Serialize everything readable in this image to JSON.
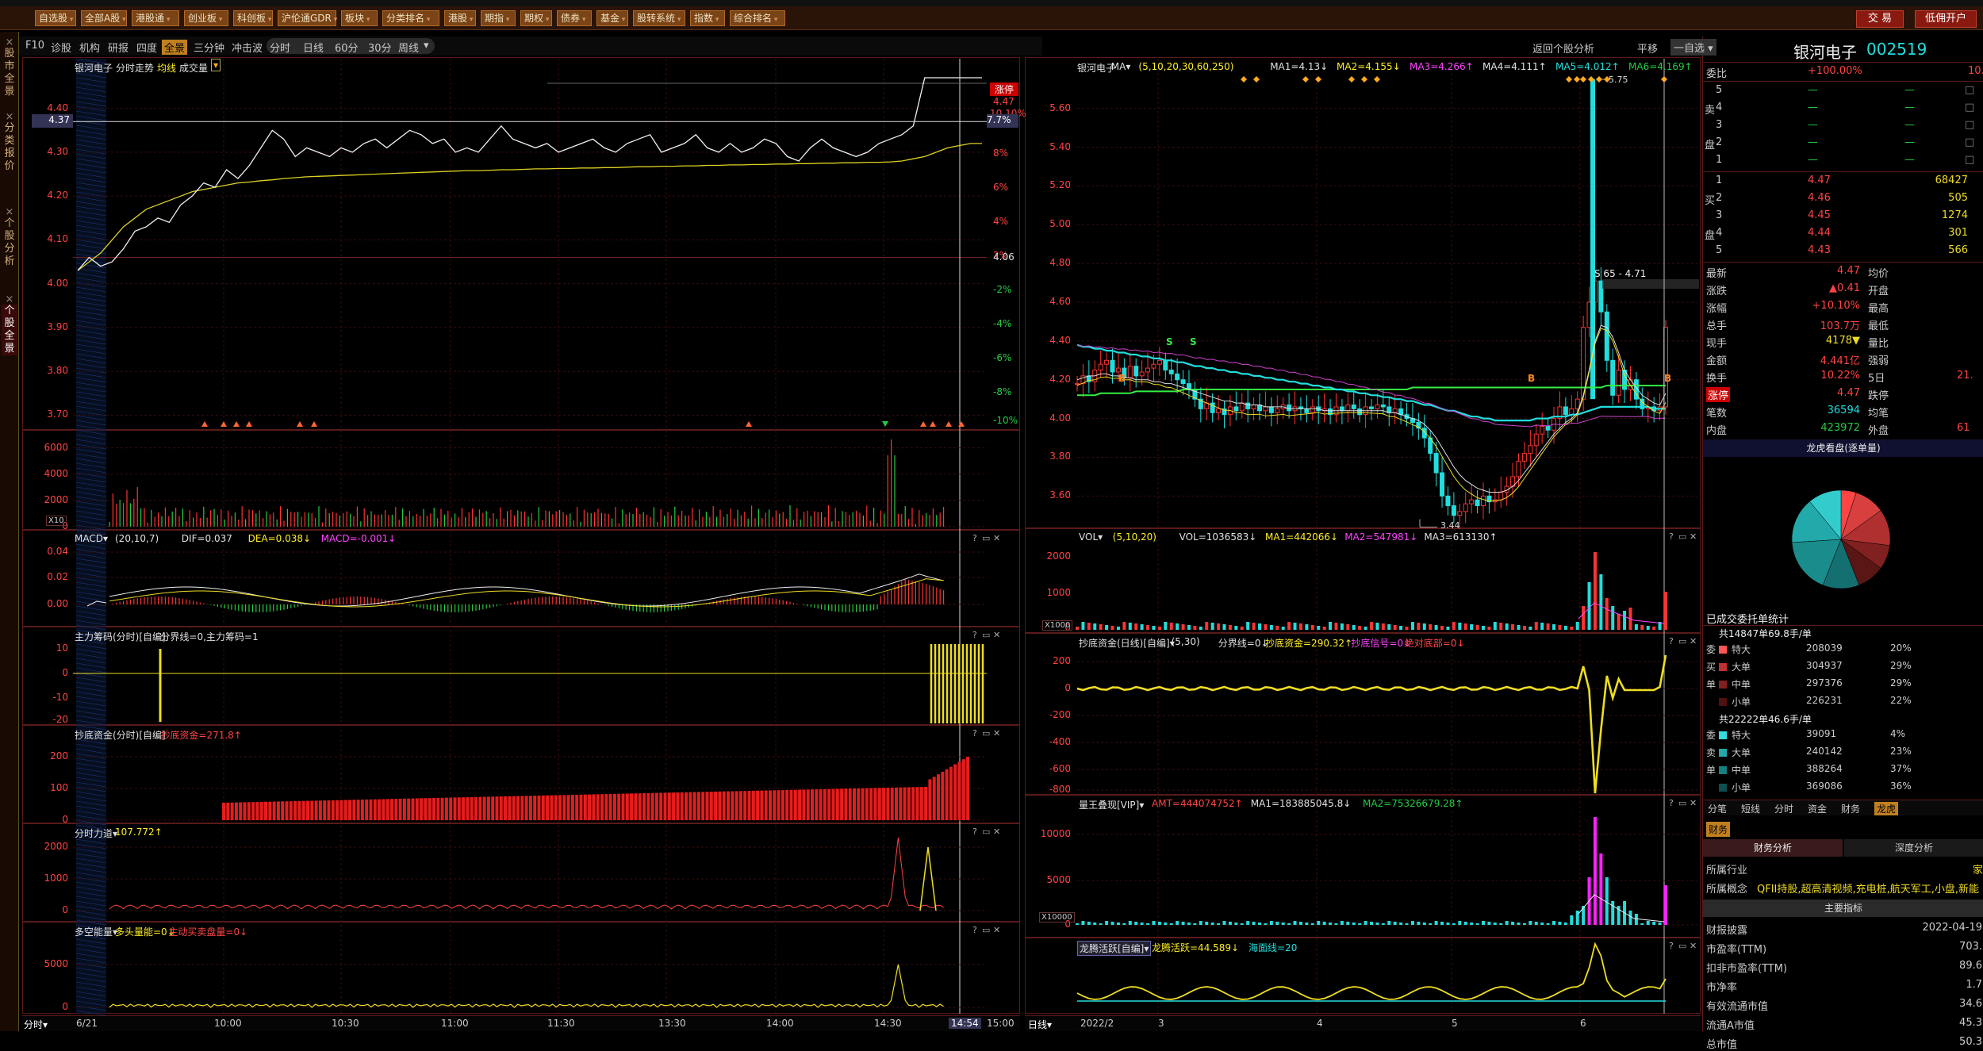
{
  "menubar": {
    "items": [
      "自选股",
      "全部A股",
      "港股通",
      "创业板",
      "科创板",
      "沪伦通GDR",
      "板块",
      "分类排名",
      "港股",
      "期指",
      "期权",
      "债券",
      "基金",
      "股转系统",
      "指数",
      "综合排名"
    ],
    "trade_button": "交 易",
    "margin_button": "低佣开户"
  },
  "leftstrip": {
    "tabs": [
      "股市全景",
      "分类报价",
      "个股分析",
      "个股全景"
    ]
  },
  "toolbar": {
    "items": [
      "F10",
      "诊股",
      "机构",
      "研报",
      "四度",
      "全景",
      "三分钟",
      "冲击波"
    ],
    "period_items": [
      "分时",
      "日线",
      "60分",
      "30分",
      "周线"
    ],
    "right_items": [
      "返回个股分析",
      "平移",
      "一自选"
    ]
  },
  "intraday": {
    "title": "银河电子",
    "subtitle": "分时走势",
    "legend_avg": "均线",
    "legend_vol": "成交量",
    "price_ticks": [
      "4.40",
      "4.30",
      "4.20",
      "4.10",
      "4.00",
      "3.90",
      "3.80",
      "3.70"
    ],
    "current_price_label": "4.37",
    "pct_ticks": [
      "8%",
      "6%",
      "4%",
      "2%",
      "4.06",
      "-2%",
      "-4%",
      "-6%",
      "-8%",
      "-10%"
    ],
    "limit_label": "涨停",
    "limit_price": "4.47",
    "limit_pct": "10.10%",
    "right_pct_label": "7.7%",
    "vol_ticks": [
      "6000",
      "4000",
      "2000",
      "0"
    ],
    "vol_unit": "X10",
    "price_series": [
      4.03,
      4.06,
      4.04,
      4.05,
      4.08,
      4.12,
      4.13,
      4.15,
      4.14,
      4.18,
      4.2,
      4.23,
      4.22,
      4.26,
      4.24,
      4.27,
      4.31,
      4.35,
      4.33,
      4.29,
      4.31,
      4.3,
      4.29,
      4.31,
      4.3,
      4.32,
      4.33,
      4.31,
      4.33,
      4.35,
      4.34,
      4.32,
      4.33,
      4.3,
      4.31,
      4.3,
      4.33,
      4.36,
      4.33,
      4.32,
      4.31,
      4.32,
      4.3,
      4.31,
      4.32,
      4.33,
      4.31,
      4.3,
      4.32,
      4.33,
      4.34,
      4.3,
      4.31,
      4.32,
      4.34,
      4.31,
      4.3,
      4.32,
      4.3,
      4.31,
      4.33,
      4.32,
      4.29,
      4.28,
      4.31,
      4.33,
      4.31,
      4.3,
      4.29,
      4.3,
      4.32,
      4.33,
      4.34,
      4.36,
      4.47,
      4.47,
      4.47,
      4.47,
      4.47,
      4.47
    ],
    "avg_series": [
      4.03,
      4.05,
      4.07,
      4.1,
      4.13,
      4.15,
      4.17,
      4.18,
      4.19,
      4.2,
      4.21,
      4.215,
      4.22,
      4.225,
      4.23,
      4.232,
      4.235,
      4.237,
      4.24,
      4.242,
      4.244,
      4.245,
      4.246,
      4.247,
      4.248,
      4.249,
      4.25,
      4.251,
      4.252,
      4.253,
      4.254,
      4.255,
      4.256,
      4.257,
      4.258,
      4.258,
      4.259,
      4.26,
      4.26,
      4.261,
      4.262,
      4.262,
      4.263,
      4.263,
      4.264,
      4.264,
      4.265,
      4.265,
      4.266,
      4.267,
      4.267,
      4.268,
      4.268,
      4.269,
      4.269,
      4.27,
      4.27,
      4.271,
      4.271,
      4.272,
      4.272,
      4.273,
      4.273,
      4.274,
      4.274,
      4.275,
      4.275,
      4.276,
      4.276,
      4.277,
      4.277,
      4.278,
      4.28,
      4.285,
      4.29,
      4.3,
      4.31,
      4.315,
      4.32,
      4.32
    ],
    "ylim": [
      3.67,
      4.47
    ],
    "time_labels": [
      "6/21",
      "10:00",
      "10:30",
      "11:00",
      "11:30",
      "13:30",
      "14:00",
      "14:30",
      "14:54",
      "15:00"
    ],
    "bottom_label": "分时"
  },
  "macd": {
    "label": "MACD",
    "params": "(20,10,7)",
    "dif": "DIF=0.037",
    "dea": "DEA=0.038",
    "macd": "MACD=-0.001",
    "ticks": [
      "0.04",
      "0.02",
      "0.00"
    ]
  },
  "zhuli": {
    "label": "主力筹码(分时)[自编]",
    "text": "分界线=0,主力筹码=1",
    "ticks": [
      "10",
      "0",
      "-10",
      "-20"
    ]
  },
  "chaodi": {
    "label": "抄底资金(分时)[自编]",
    "text": "抄底资金=271.8",
    "ticks": [
      "200",
      "100",
      "0"
    ]
  },
  "fenshi": {
    "label": "分时力道",
    "text": "107.772",
    "ticks": [
      "2000",
      "1000",
      "0"
    ]
  },
  "duokong": {
    "label": "多空能量",
    "text1": "多头量能=0",
    "text2": "主动买卖盘量=0",
    "ticks": [
      "5000",
      "0"
    ]
  },
  "daily": {
    "title": "银河电子",
    "ma_label": "MA",
    "ma_params": "(5,10,20,30,60,250)",
    "ma1": "MA1=4.13",
    "ma2": "MA2=4.155",
    "ma3": "MA3=4.266",
    "ma4": "MA4=4.111",
    "ma5": "MA5=4.012",
    "ma6": "MA6=4.169",
    "price_ticks": [
      "5.60",
      "5.40",
      "5.20",
      "5.00",
      "4.80",
      "4.60",
      "4.40",
      "4.20",
      "4.00",
      "3.80",
      "3.60"
    ],
    "ylim": [
      3.45,
      5.75
    ],
    "high_label": "5.75",
    "low_label": "3.44",
    "s_label": "S 65 - 4.71",
    "close_series": [
      4.18,
      4.22,
      4.19,
      4.25,
      4.28,
      4.3,
      4.24,
      4.26,
      4.21,
      4.27,
      4.22,
      4.24,
      4.26,
      4.28,
      4.3,
      4.25,
      4.23,
      4.2,
      4.18,
      4.15,
      4.1,
      4.05,
      4.08,
      4.03,
      4.05,
      4.02,
      4.06,
      4.04,
      4.08,
      4.05,
      4.07,
      4.04,
      4.06,
      4.03,
      4.05,
      4.07,
      4.04,
      4.06,
      4.05,
      4.03,
      4.06,
      4.04,
      4.05,
      4.02,
      4.06,
      4.04,
      4.07,
      4.05,
      4.02,
      4.06,
      4.05,
      4.07,
      4.06,
      4.03,
      4.05,
      4.02,
      4.0,
      3.98,
      3.95,
      3.9,
      3.82,
      3.72,
      3.6,
      3.55,
      3.5,
      3.52,
      3.56,
      3.58,
      3.55,
      3.6,
      3.57,
      3.58,
      3.62,
      3.65,
      3.7,
      3.78,
      3.82,
      3.86,
      3.92,
      3.96,
      3.94,
      4.0,
      4.06,
      4.02,
      4.05,
      4.1,
      4.47,
      4.6,
      4.71,
      4.55,
      4.3,
      4.12,
      4.25,
      4.15,
      4.2,
      4.1,
      4.05,
      4.06,
      4.04,
      4.06,
      4.47
    ],
    "ma_a": [
      4.2,
      4.21,
      4.22,
      4.22,
      4.23,
      4.23,
      4.22,
      4.22,
      4.21,
      4.21,
      4.2,
      4.2,
      4.2,
      4.19,
      4.19,
      4.18,
      4.18,
      4.17,
      4.16,
      4.15,
      4.14,
      4.13,
      4.12,
      4.11,
      4.1,
      4.09,
      4.09,
      4.08,
      4.08,
      4.07,
      4.07,
      4.07,
      4.06,
      4.06,
      4.06,
      4.06,
      4.05,
      4.05,
      4.05,
      4.05,
      4.05,
      4.05,
      4.04,
      4.04,
      4.04,
      4.04,
      4.04,
      4.04,
      4.04,
      4.04,
      4.04,
      4.04,
      4.04,
      4.03,
      4.03,
      4.02,
      4.01,
      4.0,
      3.99,
      3.97,
      3.94,
      3.9,
      3.85,
      3.8,
      3.75,
      3.71,
      3.68,
      3.66,
      3.64,
      3.63,
      3.62,
      3.62,
      3.62,
      3.63,
      3.65,
      3.68,
      3.72,
      3.76,
      3.8,
      3.84,
      3.88,
      3.92,
      3.95,
      3.98,
      4.0,
      4.03,
      4.12,
      4.25,
      4.4,
      4.48,
      4.47,
      4.42,
      4.34,
      4.25,
      4.2,
      4.16,
      4.12,
      4.1,
      4.08,
      4.07,
      4.13
    ],
    "ma_cyan": [
      4.38,
      4.37,
      4.37,
      4.36,
      4.36,
      4.35,
      4.35,
      4.34,
      4.34,
      4.33,
      4.33,
      4.32,
      4.32,
      4.31,
      4.31,
      4.3,
      4.3,
      4.29,
      4.29,
      4.28,
      4.27,
      4.27,
      4.26,
      4.26,
      4.25,
      4.25,
      4.24,
      4.24,
      4.23,
      4.23,
      4.22,
      4.22,
      4.21,
      4.21,
      4.2,
      4.2,
      4.19,
      4.19,
      4.18,
      4.18,
      4.17,
      4.17,
      4.16,
      4.16,
      4.15,
      4.15,
      4.14,
      4.14,
      4.13,
      4.13,
      4.12,
      4.12,
      4.11,
      4.11,
      4.1,
      4.1,
      4.09,
      4.09,
      4.08,
      4.07,
      4.07,
      4.06,
      4.05,
      4.04,
      4.04,
      4.03,
      4.02,
      4.01,
      4.01,
      4.0,
      4.0,
      3.99,
      3.99,
      3.99,
      3.99,
      3.99,
      3.99,
      3.99,
      4.0,
      4.0,
      4.0,
      4.01,
      4.01,
      4.01,
      4.02,
      4.02,
      4.03,
      4.04,
      4.05,
      4.06,
      4.06,
      4.06,
      4.06,
      4.06,
      4.06,
      4.06,
      4.06,
      4.06,
      4.05,
      4.05,
      4.05
    ],
    "ma_green": [
      4.12,
      4.12,
      4.12,
      4.12,
      4.13,
      4.13,
      4.13,
      4.13,
      4.13,
      4.13,
      4.14,
      4.14,
      4.14,
      4.14,
      4.14,
      4.14,
      4.14,
      4.14,
      4.15,
      4.15,
      4.15,
      4.15,
      4.15,
      4.15,
      4.15,
      4.15,
      4.15,
      4.15,
      4.15,
      4.15,
      4.15,
      4.15,
      4.15,
      4.15,
      4.15,
      4.15,
      4.15,
      4.15,
      4.15,
      4.15,
      4.15,
      4.15,
      4.15,
      4.15,
      4.15,
      4.15,
      4.15,
      4.15,
      4.15,
      4.15,
      4.15,
      4.15,
      4.15,
      4.15,
      4.15,
      4.15,
      4.15,
      4.16,
      4.16,
      4.16,
      4.16,
      4.16,
      4.16,
      4.16,
      4.16,
      4.16,
      4.16,
      4.16,
      4.16,
      4.16,
      4.16,
      4.16,
      4.16,
      4.16,
      4.16,
      4.16,
      4.16,
      4.16,
      4.16,
      4.16,
      4.16,
      4.16,
      4.16,
      4.16,
      4.16,
      4.16,
      4.16,
      4.16,
      4.16,
      4.16,
      4.17,
      4.17,
      4.17,
      4.17,
      4.17,
      4.17,
      4.17,
      4.17,
      4.17,
      4.17,
      4.17
    ],
    "x_labels": [
      "2022/2",
      "3",
      "4",
      "5",
      "6"
    ],
    "bottom_label": "日线"
  },
  "vol": {
    "label": "VOL",
    "params": "(5,10,20)",
    "text": "VOL=1036583",
    "ma1": "MA1=442066",
    "ma2": "MA2=547981",
    "ma3": "MA3=613130",
    "ticks": [
      "2000",
      "1000",
      "0"
    ],
    "unit": "X1000"
  },
  "chaodi_d": {
    "label": "抄底资金(日线)[自编]",
    "params": "(5,30)",
    "text": "分界线=0",
    "text2": "抄底资金=290.32",
    "text3": "抄底信号=0",
    "text4": "绝对底部=0",
    "ticks": [
      "200",
      "0",
      "-200",
      "-400",
      "-600",
      "-800"
    ]
  },
  "liangwang": {
    "label": "量王叠现[VIP]",
    "amt": "AMT=444074752",
    "ma1": "MA1=183885045.8",
    "ma2": "MA2=75326679.28",
    "ticks": [
      "10000",
      "5000",
      "0"
    ],
    "unit": "X10000"
  },
  "longteng": {
    "label": "龙腾活跃[自编]",
    "text": "龙腾活跃=44.589",
    "text2": "海面线=20"
  },
  "quote": {
    "name": "银河电子",
    "code": "002519",
    "weibi_label": "委比",
    "weibi": "+100.00%",
    "weibi_right": "10.",
    "sell": [
      {
        "label": "5",
        "price": "—",
        "vol": "—"
      },
      {
        "label": "4",
        "price": "—",
        "vol": "—"
      },
      {
        "label": "3",
        "price": "—",
        "vol": "—"
      },
      {
        "label": "2",
        "price": "—",
        "vol": "—"
      },
      {
        "label": "1",
        "price": "—",
        "vol": "—"
      }
    ],
    "buy": [
      {
        "label": "1",
        "price": "4.47",
        "vol": "68427"
      },
      {
        "label": "2",
        "price": "4.46",
        "vol": "505"
      },
      {
        "label": "3",
        "price": "4.45",
        "vol": "1274"
      },
      {
        "label": "4",
        "price": "4.44",
        "vol": "301"
      },
      {
        "label": "5",
        "price": "4.43",
        "vol": "566"
      }
    ],
    "sell_side_label": "卖",
    "buy_side_label": "买",
    "pan_label": "盘",
    "stats": [
      {
        "k": "最新",
        "v": "4.47",
        "k2": "均价",
        "v2": ""
      },
      {
        "k": "涨跌",
        "v": "▲0.41",
        "k2": "开盘",
        "v2": ""
      },
      {
        "k": "涨幅",
        "v": "+10.10%",
        "k2": "最高",
        "v2": ""
      },
      {
        "k": "总手",
        "v": "103.7万",
        "k2": "最低",
        "v2": ""
      },
      {
        "k": "现手",
        "v": "4178▼",
        "k2": "量比",
        "v2": ""
      },
      {
        "k": "金额",
        "v": "4.441亿",
        "k2": "强弱",
        "v2": ""
      },
      {
        "k": "换手",
        "v": "10.22%",
        "k2": "5日",
        "v2": "21."
      },
      {
        "k": "涨停",
        "v": "4.47",
        "k2": "跌停",
        "v2": ""
      },
      {
        "k": "笔数",
        "v": "36594",
        "k2": "均笔",
        "v2": ""
      },
      {
        "k": "内盘",
        "v": "423972",
        "k2": "外盘",
        "v2": "61"
      }
    ],
    "longhu_title": "龙虎看盘(逐单量)",
    "pie": [
      {
        "v": 5,
        "c": "#ff4444"
      },
      {
        "v": 10,
        "c": "#d84040"
      },
      {
        "v": 12,
        "c": "#b03030"
      },
      {
        "v": 8,
        "c": "#802020"
      },
      {
        "v": 9,
        "c": "#5a1515"
      },
      {
        "v": 12,
        "c": "#147070"
      },
      {
        "v": 18,
        "c": "#1a8c8c"
      },
      {
        "v": 15,
        "c": "#22aaaa"
      },
      {
        "v": 11,
        "c": "#33cccc"
      }
    ],
    "order_stats_title": "已成交委托单统计",
    "buy_total": "共14847单69.8手/单",
    "buy_rows": [
      {
        "name": "特大",
        "vol": "208039",
        "pct": "20%",
        "c": "#ff5555"
      },
      {
        "name": "大单",
        "vol": "304937",
        "pct": "29%",
        "c": "#c03030"
      },
      {
        "name": "中单",
        "vol": "297376",
        "pct": "29%",
        "c": "#802020"
      },
      {
        "name": "小单",
        "vol": "226231",
        "pct": "22%",
        "c": "#501010"
      }
    ],
    "sell_total": "共22222单46.6手/单",
    "sell_rows": [
      {
        "name": "特大",
        "vol": "39091",
        "pct": "4%",
        "c": "#33dddd"
      },
      {
        "name": "大单",
        "vol": "240142",
        "pct": "23%",
        "c": "#22aaaa"
      },
      {
        "name": "中单",
        "vol": "388264",
        "pct": "37%",
        "c": "#158080"
      },
      {
        "name": "小单",
        "vol": "369086",
        "pct": "36%",
        "c": "#0d5050"
      }
    ],
    "buy_side_labels": [
      "委",
      "买",
      "单"
    ],
    "sell_side_labels": [
      "委",
      "卖",
      "单"
    ],
    "tabs": [
      "分笔",
      "短线",
      "分时",
      "资金",
      "财务",
      "龙虎"
    ],
    "fin_tab": "财务",
    "fin_subtabs": [
      "财务分析",
      "深度分析"
    ],
    "industry_label": "所属行业",
    "industry_value": "家",
    "concept_label": "所属概念",
    "concept_value": "QFII持股,超高清视频,充电桩,航天军工,小盘,新能",
    "main_title": "主要指标",
    "fin_rows": [
      {
        "k": "财报披露",
        "v": "2022-04-19"
      },
      {
        "k": "市盈率(TTM)",
        "v": "703."
      },
      {
        "k": "扣非市盈率(TTM)",
        "v": "89.6"
      },
      {
        "k": "市净率",
        "v": "1.7"
      },
      {
        "k": "有效流通市值",
        "v": "34.6"
      },
      {
        "k": "流通A市值",
        "v": "45.3"
      },
      {
        "k": "总市值",
        "v": "50.3"
      }
    ]
  }
}
